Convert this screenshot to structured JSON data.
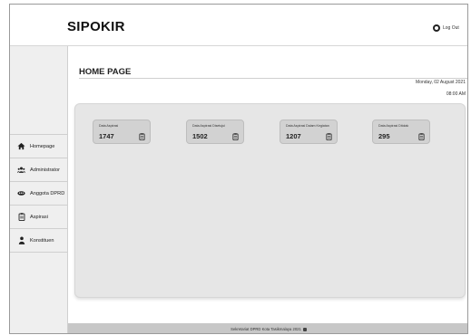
{
  "header": {
    "brand": "SIPOKIR",
    "logout_label": "Log Out"
  },
  "sidebar": {
    "items": [
      {
        "label": "Homepage",
        "icon": "home-icon"
      },
      {
        "label": "Administrator",
        "icon": "users-icon"
      },
      {
        "label": "Anggota DPRD",
        "icon": "group-icon"
      },
      {
        "label": "Aspirasi",
        "icon": "clipboard-icon"
      },
      {
        "label": "Konstituen",
        "icon": "person-icon"
      }
    ]
  },
  "main": {
    "page_title": "HOME PAGE",
    "date": "Monday, 02 August 2021",
    "time": "08:00 AM",
    "cards": [
      {
        "label": "Data Aspirasi",
        "value": "1747"
      },
      {
        "label": "Data Aspirasi Disetujui",
        "value": "1502"
      },
      {
        "label": "Data Aspirasi Dalam Kegiatan",
        "value": "1207"
      },
      {
        "label": "Data Aspirasi Ditolak",
        "value": "295"
      }
    ]
  },
  "footer": {
    "text": "Sekretariat DPRD Kota Tasikmalaya 2021"
  }
}
